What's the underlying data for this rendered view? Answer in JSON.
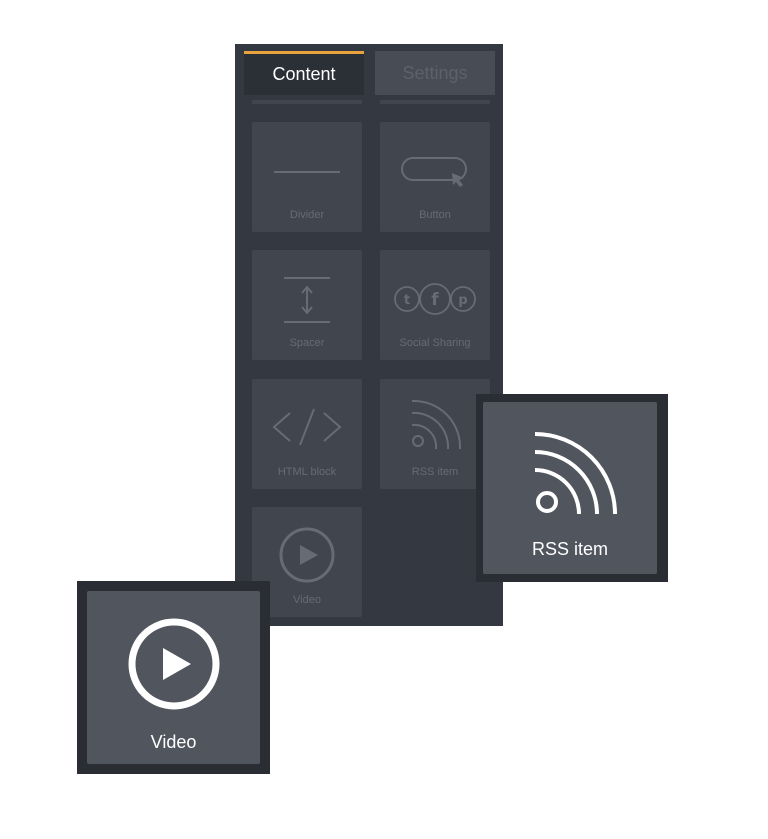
{
  "tabs": {
    "content_label": "Content",
    "settings_label": "Settings",
    "active": "Content",
    "active_color": "#e8a33d"
  },
  "blocks": [
    {
      "label": "Divider",
      "icon": "divider-icon"
    },
    {
      "label": "Button",
      "icon": "button-cursor-icon"
    },
    {
      "label": "Spacer",
      "icon": "spacer-icon"
    },
    {
      "label": "Social Sharing",
      "icon": "social-icons"
    },
    {
      "label": "HTML block",
      "icon": "code-icon"
    },
    {
      "label": "RSS item",
      "icon": "rss-icon"
    },
    {
      "label": "Video",
      "icon": "play-icon"
    }
  ],
  "zoom": {
    "rss_label": "RSS item",
    "video_label": "Video"
  }
}
